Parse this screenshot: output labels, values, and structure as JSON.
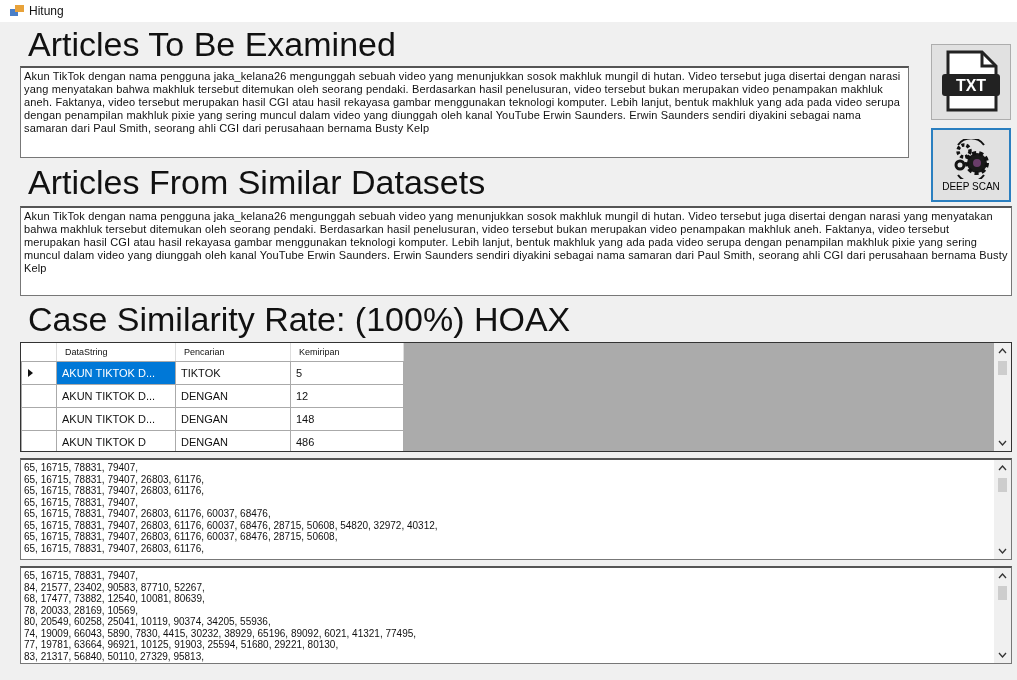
{
  "window": {
    "title": "Hitung"
  },
  "examined": {
    "heading": "Articles To Be Examined",
    "text": "Akun TikTok dengan nama pengguna jaka_kelana26 mengunggah sebuah video yang menunjukkan sosok makhluk mungil di hutan. Video tersebut juga disertai dengan narasi yang menyatakan bahwa makhluk tersebut ditemukan oleh seorang pendaki. Berdasarkan hasil penelusuran, video tersebut bukan merupakan video penampakan makhluk aneh. Faktanya, video tersebut merupakan hasil CGI atau hasil rekayasa gambar menggunakan teknologi komputer. Lebih lanjut, bentuk makhluk yang ada pada video serupa dengan penampilan makhluk pixie yang sering muncul dalam video yang diunggah oleh kanal YouTube Erwin Saunders. Erwin Saunders sendiri diyakini sebagai nama samaran dari Paul Smith, seorang ahli CGI dari perusahaan bernama Busty Kelp"
  },
  "buttons": [
    {
      "kind": "txt",
      "label": "TXT"
    },
    {
      "kind": "scan",
      "label": "DEEP SCAN"
    }
  ],
  "similar": {
    "heading": "Articles From Similar Datasets",
    "text": "Akun TikTok dengan nama pengguna jaka_kelana26 mengunggah sebuah video yang menunjukkan sosok makhluk mungil di hutan. Video tersebut juga disertai dengan narasi yang menyatakan bahwa makhluk tersebut ditemukan oleh seorang pendaki. Berdasarkan hasil penelusuran, video tersebut bukan merupakan video penampakan makhluk aneh. Faktanya, video tersebut merupakan hasil CGI atau hasil rekayasa gambar menggunakan teknologi komputer. Lebih lanjut, bentuk makhluk yang ada pada video serupa dengan penampilan makhluk pixie yang sering muncul dalam video yang diunggah oleh kanal YouTube Erwin Saunders. Erwin Saunders sendiri diyakini sebagai nama samaran dari Paul Smith, seorang ahli CGI dari perusahaan bernama Busty Kelp"
  },
  "result": {
    "heading": "Case Similarity Rate: (100%) HOAX"
  },
  "table": {
    "columns": [
      "DataString",
      "Pencarian",
      "Kemiripan"
    ],
    "rows": [
      {
        "cells": [
          "AKUN TIKTOK D...",
          "TIKTOK",
          "5"
        ],
        "selected": true
      },
      {
        "cells": [
          "AKUN TIKTOK D...",
          "DENGAN",
          "12"
        ],
        "selected": false
      },
      {
        "cells": [
          "AKUN TIKTOK D...",
          "DENGAN",
          "148"
        ],
        "selected": false
      },
      {
        "cells": [
          "AKUN TIKTOK D",
          "DENGAN",
          "486"
        ],
        "selected": false
      }
    ]
  },
  "output_1": [
    "65, 16715, 78831, 79407,",
    "65, 16715, 78831, 79407, 26803, 61176,",
    "65, 16715, 78831, 79407, 26803, 61176,",
    "65, 16715, 78831, 79407,",
    "65, 16715, 78831, 79407, 26803, 61176, 60037, 68476,",
    "65, 16715, 78831, 79407, 26803, 61176, 60037, 68476, 28715, 50608, 54820, 32972, 40312,",
    "65, 16715, 78831, 79407, 26803, 61176, 60037, 68476, 28715, 50608,",
    "65, 16715, 78831, 79407, 26803, 61176,"
  ],
  "output_2": [
    "65, 16715, 78831, 79407,",
    "84, 21577, 23402, 90583, 87710, 52267,",
    "68, 17477, 73882, 12540, 10081, 80639,",
    "78, 20033, 28169, 10569,",
    "80, 20549, 60258, 25041, 10119, 90374, 34205, 55936,",
    "74, 19009, 66043, 5890, 7830, 4415, 30232, 38929, 65196, 89092, 6021, 41321, 77495,",
    "77, 19781, 63664, 96921, 10125, 91903, 25594, 51680, 29221, 80130,",
    "83, 21317, 56840, 50110, 27329, 95813,"
  ]
}
